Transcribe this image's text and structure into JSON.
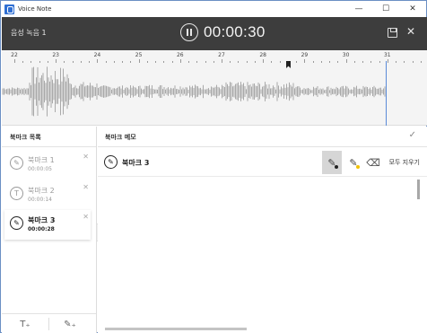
{
  "window": {
    "title": "Voice Note",
    "minimize": "—",
    "maximize": "☐",
    "close": "✕"
  },
  "header": {
    "recording_title": "음성 녹음 1",
    "timer": "00:00:30",
    "close_label": "✕"
  },
  "ruler": {
    "labels": [
      "22",
      "23",
      "24",
      "25",
      "26",
      "27",
      "28",
      "29",
      "30",
      "31"
    ]
  },
  "bookmarks": {
    "title": "북마크 목록",
    "items": [
      {
        "name": "북마크 1",
        "time": "00:00:05",
        "icon_glyph": "✎",
        "icon": "pen-icon"
      },
      {
        "name": "북마크 2",
        "time": "00:00:14",
        "icon_glyph": "T",
        "icon": "text-icon"
      },
      {
        "name": "북마크 3",
        "time": "00:00:28",
        "icon_glyph": "✎",
        "icon": "pen-icon"
      }
    ],
    "delete_label": "✕",
    "add_text_label": "T₊",
    "add_drawing_label": "✎₊"
  },
  "memo": {
    "title": "북마크 메모",
    "confirm_label": "✓",
    "bookmark_name": "북마크 3",
    "bookmark_icon_glyph": "✎",
    "tools": {
      "pen_glyph": "✎",
      "highlighter_glyph": "✎",
      "eraser_glyph": "⌫"
    },
    "clear_all_label": "모두 지우기"
  },
  "colors": {
    "header_bg": "#3d3d3d",
    "accent": "#5a8ad8",
    "pen_color": "#222222",
    "highlighter_color": "#f2c200"
  }
}
